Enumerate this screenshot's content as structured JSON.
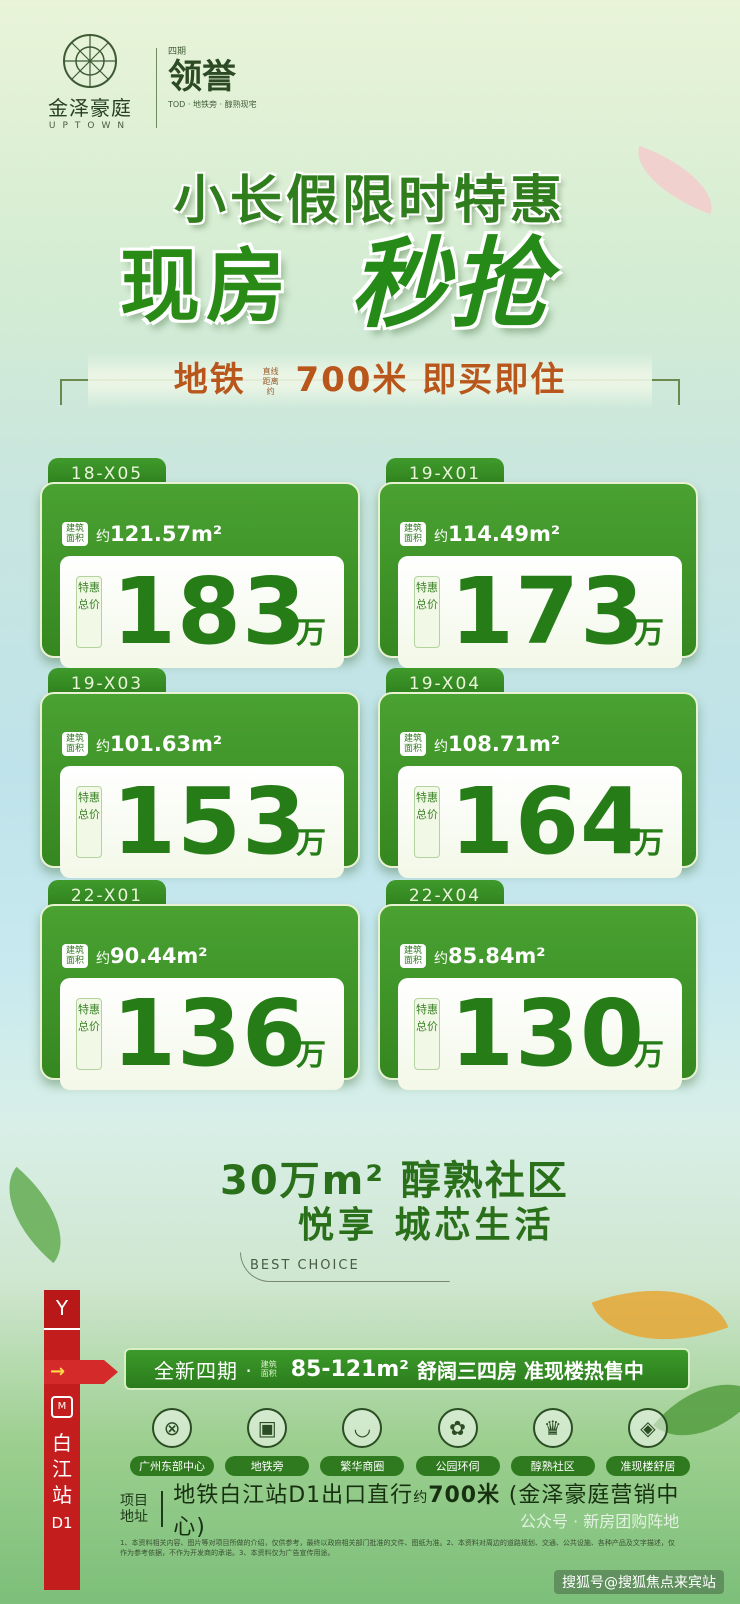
{
  "brand": {
    "left_name": "金泽豪庭",
    "left_en": "UPTOWN",
    "right_small": "四期",
    "right_name": "领誉",
    "right_tag": "TOD · 地铁旁 · 醇熟现宅"
  },
  "headline": {
    "line1": "小长假限时特惠",
    "line2a": "现房",
    "line2b": "秒抢",
    "sub_left": "地铁",
    "sub_tiny": "直线距离约",
    "sub_right": "700米 即买即住"
  },
  "cards": [
    {
      "code": "18-X05",
      "area_label": "建筑面积",
      "area_prefix": "约",
      "area": "121.57m²",
      "price_label": "特惠总价",
      "price": "183",
      "unit": "万"
    },
    {
      "code": "19-X01",
      "area_label": "建筑面积",
      "area_prefix": "约",
      "area": "114.49m²",
      "price_label": "特惠总价",
      "price": "173",
      "unit": "万"
    },
    {
      "code": "19-X03",
      "area_label": "建筑面积",
      "area_prefix": "约",
      "area": "101.63m²",
      "price_label": "特惠总价",
      "price": "153",
      "unit": "万"
    },
    {
      "code": "19-X04",
      "area_label": "建筑面积",
      "area_prefix": "约",
      "area": "108.71m²",
      "price_label": "特惠总价",
      "price": "164",
      "unit": "万"
    },
    {
      "code": "22-X01",
      "area_label": "建筑面积",
      "area_prefix": "约",
      "area": "90.44m²",
      "price_label": "特惠总价",
      "price": "136",
      "unit": "万"
    },
    {
      "code": "22-X04",
      "area_label": "建筑面积",
      "area_prefix": "约",
      "area": "85.84m²",
      "price_label": "特惠总价",
      "price": "130",
      "unit": "万"
    }
  ],
  "slogan": {
    "line1": "30万m² 醇熟社区",
    "line2": "悦享 城芯生活",
    "best": "BEST CHOICE"
  },
  "phase": {
    "title": "全新四期 ·",
    "tiny": "建筑面积",
    "area": "85-121m²",
    "desc": "舒阔三四房 准现楼热售中"
  },
  "features": [
    {
      "icon": "compass-icon",
      "glyph": "⊗",
      "label": "广州东部中心"
    },
    {
      "icon": "train-icon",
      "glyph": "🚆",
      "label": "地铁旁"
    },
    {
      "icon": "cup-icon",
      "glyph": "☕",
      "label": "繁华商圈"
    },
    {
      "icon": "tree-icon",
      "glyph": "✿",
      "label": "公园环伺"
    },
    {
      "icon": "crown-icon",
      "glyph": "♛",
      "label": "醇熟社区"
    },
    {
      "icon": "gem-icon",
      "glyph": "◈",
      "label": "准现楼舒居"
    }
  ],
  "address": {
    "key": "项目地址",
    "value": "地铁白江站D1出口直行",
    "about": "约",
    "distance": "700米",
    "place": "(金泽豪庭营销中心)"
  },
  "fine_print": "1、本资料相关内容、图片等对项目所做的介绍，仅供参考，最终以政府相关部门批准的文件、图纸为准。2、本资料对周边的道路规划、交通、公共设施、各种产品及文字描述，仅作为参考依据，不作为开发商的承诺。3、本资料仅为广告宣传用途。",
  "side_sign": {
    "top": "Y",
    "station": "白江站",
    "exit": "D1",
    "metro": "M"
  },
  "watermark": "搜狐号@搜狐焦点来宾站",
  "watermark2": "公众号 · 新房团购阵地",
  "colors": {
    "primary_green": "#2f7d1c",
    "accent_orange": "#b8561b",
    "sign_red": "#c41d1d"
  }
}
